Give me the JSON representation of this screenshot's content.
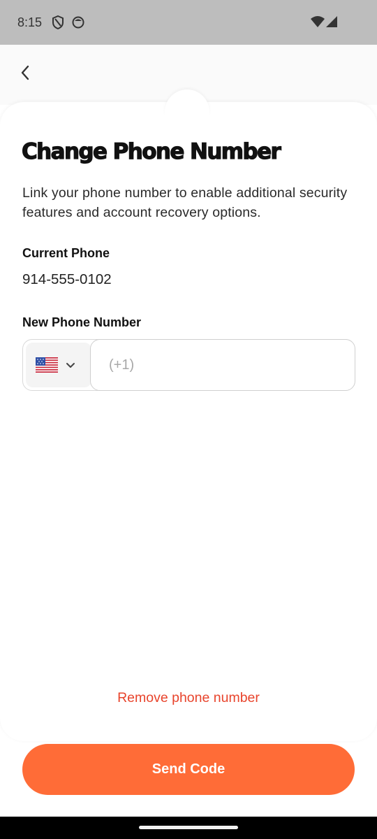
{
  "status_bar": {
    "time": "8:15",
    "icons": [
      "shield-icon",
      "face-icon",
      "wifi-icon",
      "signal-icon"
    ]
  },
  "header": {
    "back_icon": "chevron-left-icon"
  },
  "page": {
    "title": "Change Phone Number",
    "description": "Link your phone number to enable additional security features and account recovery options."
  },
  "current_phone": {
    "label": "Current Phone",
    "value": "914-555-0102"
  },
  "new_phone": {
    "label": "New Phone Number",
    "country_flag": "us-flag-icon",
    "placeholder": "(+1)",
    "value": ""
  },
  "actions": {
    "remove_label": "Remove phone number",
    "send_label": "Send Code"
  },
  "colors": {
    "accent": "#ff6c37",
    "danger": "#e8442c"
  }
}
